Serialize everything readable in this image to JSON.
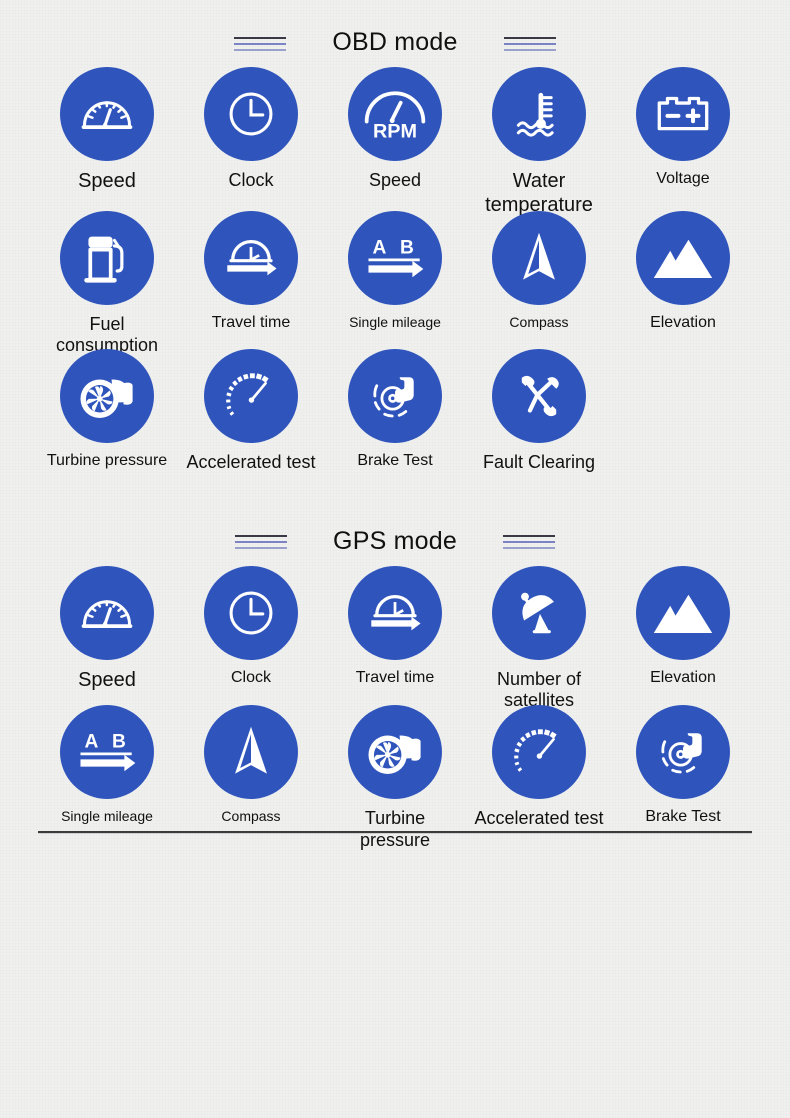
{
  "sections": [
    {
      "title": "OBD mode",
      "rows": [
        [
          {
            "icon": "speedometer-icon",
            "label": "Speed",
            "size": "s-xl"
          },
          {
            "icon": "clock-icon",
            "label": "Clock",
            "size": "s-lg"
          },
          {
            "icon": "rpm-gauge-icon",
            "label": "Speed",
            "size": "s-lg"
          },
          {
            "icon": "water-temperature-icon",
            "label": "Water temperature",
            "size": "s-xl"
          },
          {
            "icon": "battery-voltage-icon",
            "label": "Voltage",
            "size": "s-md"
          }
        ],
        [
          {
            "icon": "fuel-pump-icon",
            "label": "Fuel consumption",
            "size": "s-lg"
          },
          {
            "icon": "travel-time-icon",
            "label": "Travel time",
            "size": "s-md"
          },
          {
            "icon": "single-mileage-icon",
            "label": "Single mileage",
            "size": "s-sm"
          },
          {
            "icon": "compass-icon",
            "label": "Compass",
            "size": "s-sm"
          },
          {
            "icon": "elevation-icon",
            "label": "Elevation",
            "size": "s-md"
          }
        ],
        [
          {
            "icon": "turbine-icon",
            "label": "Turbine pressure",
            "size": "s-md"
          },
          {
            "icon": "accelerated-test-icon",
            "label": "Accelerated test",
            "size": "s-lg"
          },
          {
            "icon": "brake-disc-icon",
            "label": "Brake Test",
            "size": "s-md"
          },
          {
            "icon": "wrench-spanner-icon",
            "label": "Fault Clearing",
            "size": "s-lg"
          }
        ]
      ]
    },
    {
      "title": "GPS mode",
      "rows": [
        [
          {
            "icon": "speedometer-icon",
            "label": "Speed",
            "size": "s-xl"
          },
          {
            "icon": "clock-icon",
            "label": "Clock",
            "size": "s-md"
          },
          {
            "icon": "travel-time-icon",
            "label": "Travel time",
            "size": "s-md"
          },
          {
            "icon": "satellite-dish-icon",
            "label": "Number of satellites",
            "size": "s-lg"
          },
          {
            "icon": "elevation-icon",
            "label": "Elevation",
            "size": "s-md"
          }
        ],
        [
          {
            "icon": "single-mileage-icon",
            "label": "Single mileage",
            "size": "s-sm"
          },
          {
            "icon": "compass-icon",
            "label": "Compass",
            "size": "s-sm"
          },
          {
            "icon": "turbine-icon",
            "label": "Turbine pressure",
            "size": "s-lg"
          },
          {
            "icon": "accelerated-test-icon",
            "label": "Accelerated test",
            "size": "s-lg"
          },
          {
            "icon": "brake-disc-icon",
            "label": "Brake Test",
            "size": "s-md"
          }
        ]
      ]
    }
  ],
  "colors": {
    "disc_blue": "#2f55bd",
    "icon_white": "#ffffff",
    "background": "#f0f0ee",
    "text": "#111111",
    "rule_dark": "#3a3a46",
    "rule_blue": "#7b83c4"
  }
}
